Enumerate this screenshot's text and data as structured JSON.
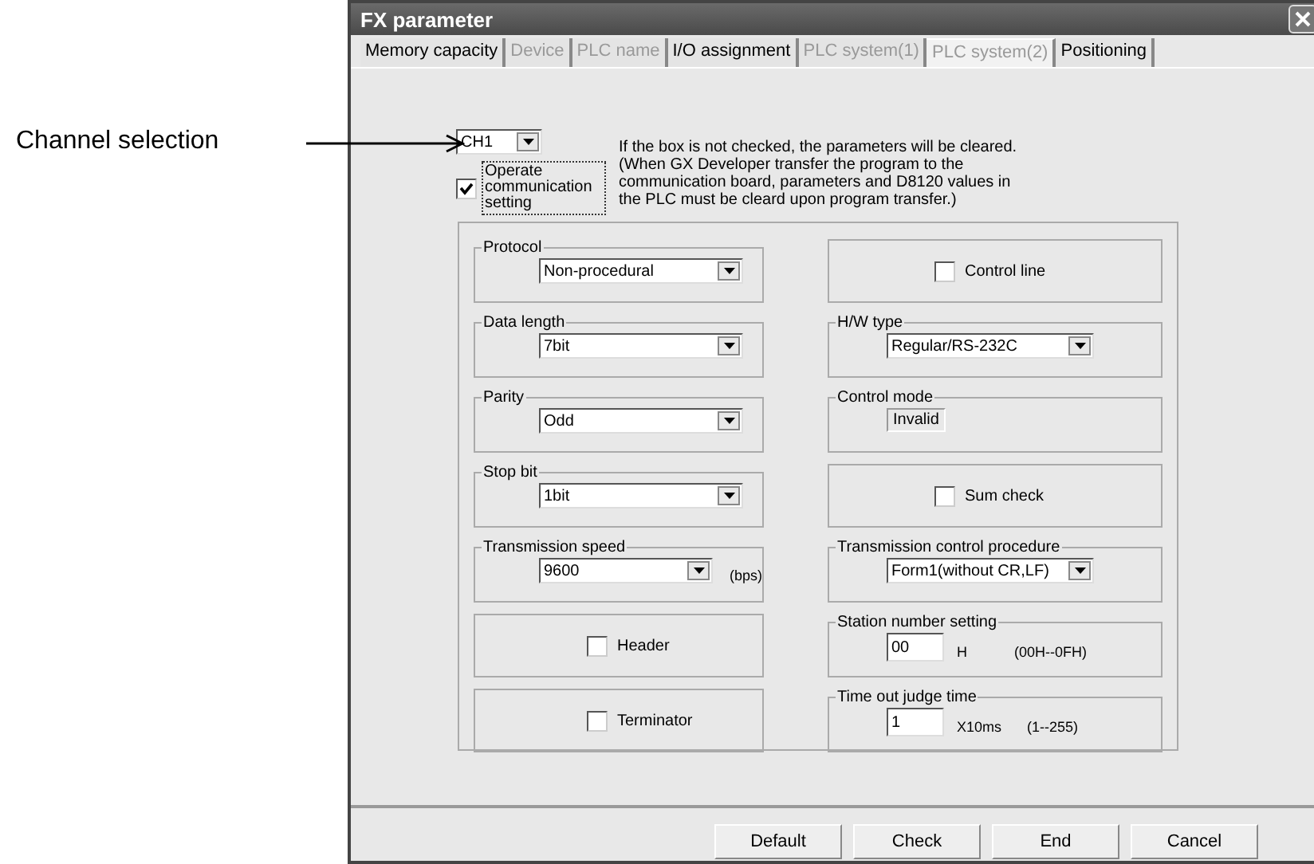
{
  "annotation": {
    "label": "Channel selection"
  },
  "window": {
    "title": "FX parameter"
  },
  "tabs": [
    {
      "label": "Memory capacity",
      "selected": false,
      "disabled": false
    },
    {
      "label": "Device",
      "selected": false,
      "disabled": true
    },
    {
      "label": "PLC name",
      "selected": false,
      "disabled": true
    },
    {
      "label": "I/O assignment",
      "selected": false,
      "disabled": false
    },
    {
      "label": "PLC system(1)",
      "selected": false,
      "disabled": true
    },
    {
      "label": "PLC system(2)",
      "selected": true,
      "disabled": true
    },
    {
      "label": "Positioning",
      "selected": false,
      "disabled": false
    }
  ],
  "channel": {
    "value": "CH1"
  },
  "operate": {
    "label": "Operate communication setting",
    "checked": true
  },
  "note": [
    "If the box is not checked, the parameters will be cleared.",
    "(When GX Developer transfer the program to the communication board, parameters and D8120 values in the PLC must be cleard upon program transfer.)"
  ],
  "settings": [
    {
      "kind": "select",
      "legend": "Protocol",
      "value": "Non-procedural"
    },
    {
      "kind": "checkbox",
      "label": "Control line",
      "checked": false
    },
    {
      "kind": "select",
      "legend": "Data length",
      "value": "7bit"
    },
    {
      "kind": "select",
      "legend": "H/W type",
      "value": "Regular/RS-232C"
    },
    {
      "kind": "select",
      "legend": "Parity",
      "value": "Odd"
    },
    {
      "kind": "readonly",
      "legend": "Control mode",
      "value": "Invalid"
    },
    {
      "kind": "select",
      "legend": "Stop bit",
      "value": "1bit"
    },
    {
      "kind": "checkbox",
      "label": "Sum check",
      "checked": false
    },
    {
      "kind": "select",
      "legend": "Transmission speed",
      "value": "9600",
      "unit": "(bps)"
    },
    {
      "kind": "select",
      "legend": "Transmission control procedure",
      "value": "Form1(without CR,LF)"
    },
    {
      "kind": "checkbox",
      "label": "Header",
      "checked": false
    },
    {
      "kind": "input",
      "legend": "Station number setting",
      "value": "00",
      "unit": "H",
      "range": "(00H--0FH)"
    },
    {
      "kind": "checkbox",
      "label": "Terminator",
      "checked": false
    },
    {
      "kind": "input",
      "legend": "Time out judge time",
      "value": "1",
      "unit": "X10ms",
      "range": "(1--255)"
    }
  ],
  "buttons": [
    "Default",
    "Check",
    "End",
    "Cancel"
  ]
}
